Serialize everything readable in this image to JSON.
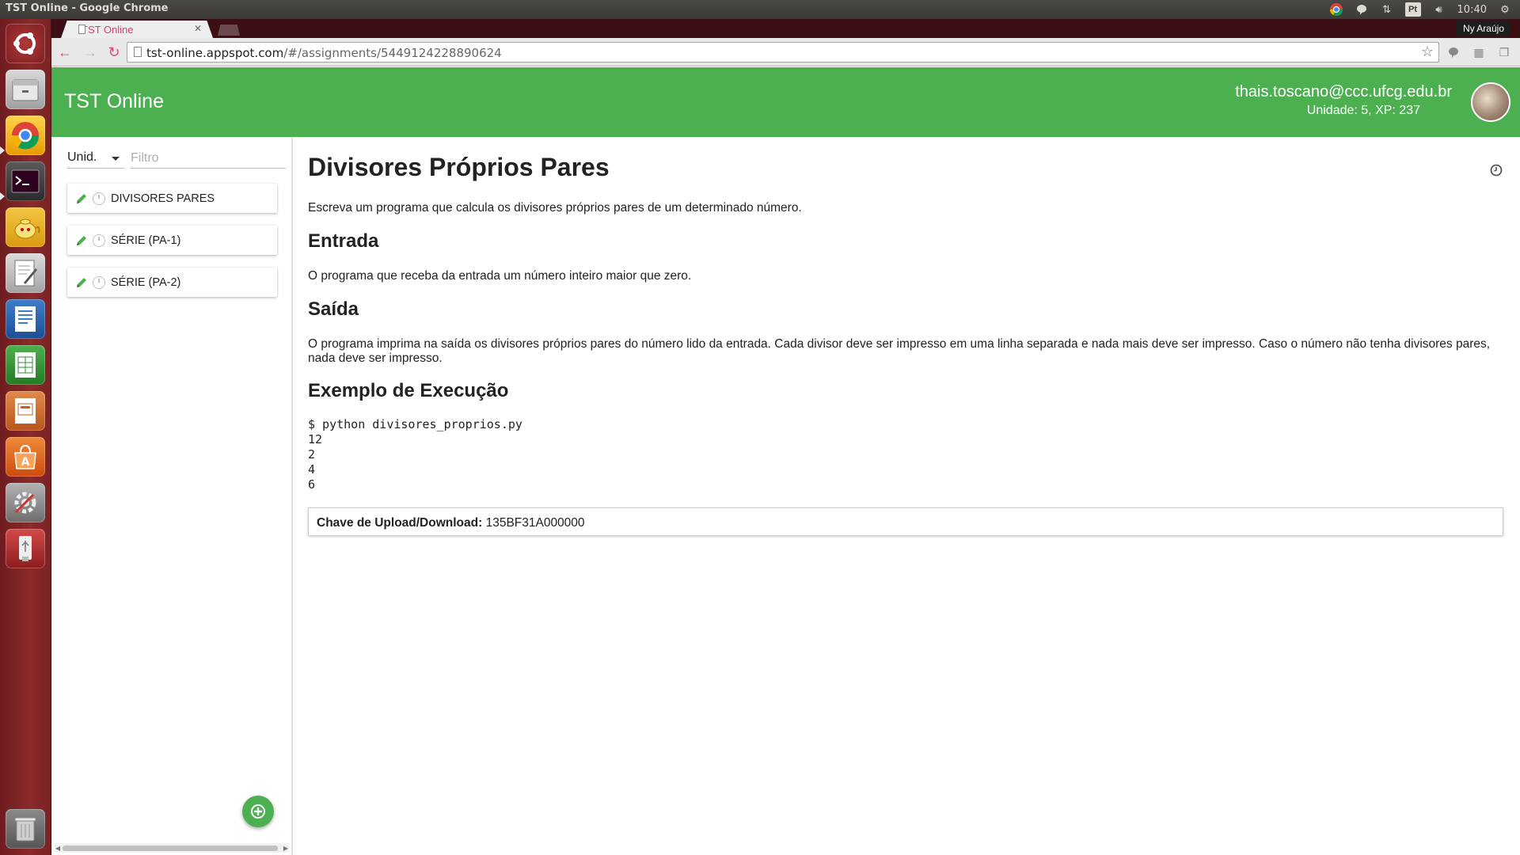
{
  "window": {
    "title": "TST Online - Google Chrome",
    "clock": "10:40",
    "language": "Pt",
    "user_name": "Ny Araújo"
  },
  "browser": {
    "tab_title": "TST Online",
    "url_host": "tst-online.appspot.com",
    "url_path": "/#/assignments/5449124228890624"
  },
  "header": {
    "app_title": "TST Online",
    "user_email": "thais.toscano@ccc.ufcg.edu.br",
    "user_stats": "Unidade: 5, XP: 237"
  },
  "sidebar": {
    "unit_label": "Unid.",
    "filter_placeholder": "Filtro",
    "items": [
      {
        "label": "DIVISORES PARES"
      },
      {
        "label": "SÉRIE (PA-1)"
      },
      {
        "label": "SÉRIE (PA-2)"
      }
    ]
  },
  "assignment": {
    "title": "Divisores Próprios Pares",
    "description": "Escreva um programa que calcula os divisores próprios pares de um determinado número.",
    "input_heading": "Entrada",
    "input_text": "O programa que receba da entrada um número inteiro maior que zero.",
    "output_heading": "Saída",
    "output_text": "O programa imprima na saída os divisores próprios pares do número lido da entrada. Cada divisor deve ser impresso em uma linha separada e nada mais deve ser impresso. Caso o número não tenha divisores pares, nada deve ser impresso.",
    "example_heading": "Exemplo de Execução",
    "example_code": "$ python divisores_proprios.py\n12\n2\n4\n6",
    "key_label": "Chave de Upload/Download:",
    "key_value": "135BF31A000000"
  },
  "colors": {
    "header_green": "#4caf50",
    "launcher_red": "#8a2a2a",
    "pencil_green": "#4caf50"
  }
}
